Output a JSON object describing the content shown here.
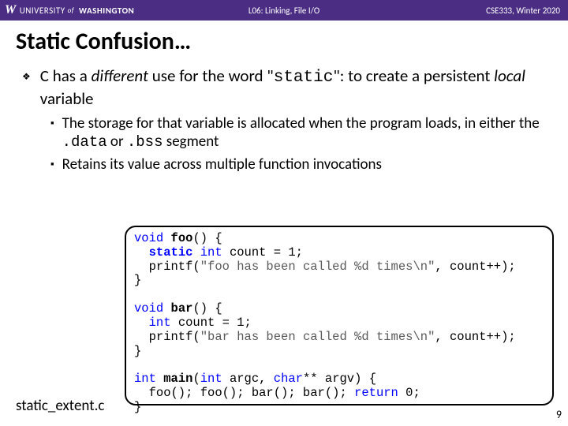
{
  "header": {
    "logo_w": "W",
    "logo_text1": "UNIVERSITY",
    "logo_of": "of",
    "logo_text2": "WASHINGTON",
    "center": "L06: Linking, File I/O",
    "right": "CSE333, Winter 2020"
  },
  "title": "Static Confusion…",
  "bullet1_pre": "C has a ",
  "bullet1_diff": "different",
  "bullet1_mid": " use for the word \"",
  "bullet1_static": "static",
  "bullet1_post1": "\":  to create a persistent ",
  "bullet1_local": "local",
  "bullet1_post2": " variable",
  "sub1_pre": "The storage for that variable is allocated when the program loads, in either the ",
  "sub1_seg1": ".data",
  "sub1_or": " or ",
  "sub1_seg2": ".bss",
  "sub1_post": " segment",
  "sub2": "Retains its value across multiple function invocations",
  "code": {
    "l1a": "void",
    "l1b": " ",
    "l1c": "foo",
    "l1d": "() {",
    "l2a": "  ",
    "l2b": "static",
    "l2c": " ",
    "l2d": "int",
    "l2e": " count = 1;",
    "l3a": "  printf(",
    "l3b": "\"foo has been called %d times\\n\"",
    "l3c": ", count++);",
    "l4": "}",
    "l5a": "void",
    "l5b": " ",
    "l5c": "bar",
    "l5d": "() {",
    "l6a": "  ",
    "l6b": "int",
    "l6c": " count = 1;",
    "l7a": "  printf(",
    "l7b": "\"bar has been called %d times\\n\"",
    "l7c": ", count++);",
    "l8": "}",
    "l9a": "int",
    "l9b": " ",
    "l9c": "main",
    "l9d": "(",
    "l9e": "int",
    "l9f": " argc, ",
    "l9g": "char",
    "l9h": "** argv) {",
    "l10a": "  foo(); foo(); bar(); bar(); ",
    "l10b": "return",
    "l10c": " 0;",
    "l11": "}"
  },
  "filename": "static_extent.c",
  "pagenum": "9"
}
